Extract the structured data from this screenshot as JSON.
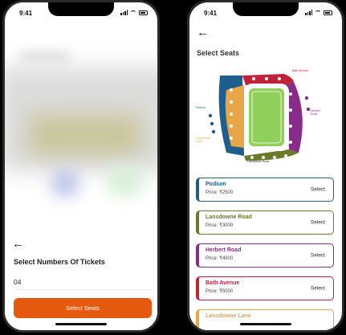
{
  "status": {
    "time": "9:41"
  },
  "left": {
    "title": "Select Numbers Of Tickets",
    "tickets_value": "04",
    "button_label": "Select Seats"
  },
  "right": {
    "title": "Select Seats",
    "map_labels": {
      "bath_avenue": "Bath Avenue",
      "podium": "Podium",
      "herbert_road": "Herbert Road",
      "lansdowne_road": "Lansdowne Road",
      "lansdowne_lane": "Lansdowne Lane"
    },
    "stands": [
      {
        "name": "Podium",
        "price": "Price: ₹2500",
        "action": "Select",
        "color": "#1e5e8c"
      },
      {
        "name": "Lansdowne Road",
        "price": "Price: ₹3000",
        "action": "Select",
        "color": "#6a7a2a"
      },
      {
        "name": "Herbert Road",
        "price": "Price: ₹4000",
        "action": "Select",
        "color": "#8a2b8a"
      },
      {
        "name": "Bath Avenue",
        "price": "Price: ₹5000",
        "action": "Select",
        "color": "#c0223a"
      },
      {
        "name": "Lansdowne Lane",
        "price": "",
        "action": "",
        "color": "#e9a646"
      }
    ]
  }
}
